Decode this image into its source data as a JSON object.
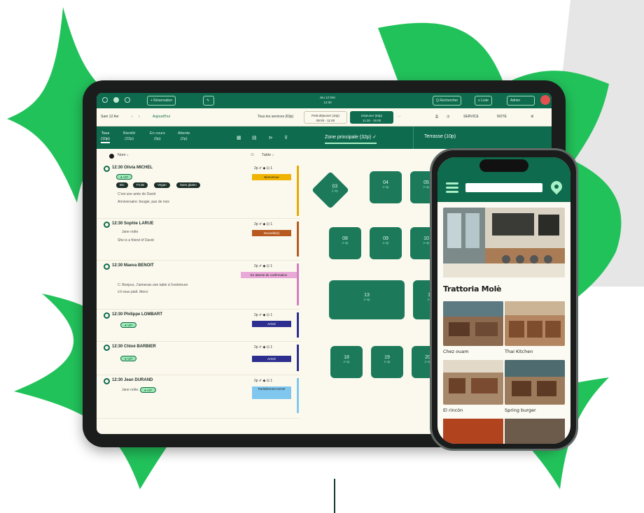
{
  "topbar": {
    "new_res_label": "+ Réservation",
    "center_line1": "Jeu 12 Déc",
    "center_line2": "12:30",
    "search_label": "Q Rechercher",
    "lists_label": "≡ Liste",
    "user_label": "Admin"
  },
  "toolbar": {
    "date": "Sam 12 Avr",
    "today": "Aujourd'hui",
    "all_services": "Tous les services (63p)",
    "service_lunch_line1": "Petit-déjeuner (10p)",
    "service_lunch_line2": "08:00 - 11:00",
    "service_dinner_line1": "Déjeuner (53p)",
    "service_dinner_line2": "11:30 - 15:00",
    "service_btn": "SERVICE",
    "note_btn": "NOTE"
  },
  "tabs": [
    {
      "line1": "Tous",
      "line2": "(10p)"
    },
    {
      "line1": "Bientôt",
      "line2": "(22p)"
    },
    {
      "line1": "En cours",
      "line2": "(9p)"
    },
    {
      "line1": "Attente",
      "line2": "(2p)"
    }
  ],
  "zones": {
    "main": "Zone principale (32p) ✓",
    "terrace": "Terrasse (10p)"
  },
  "list_header": {
    "sort_name": "Nom ↓",
    "sort_table": "Table ↓"
  },
  "reservations": [
    {
      "time_name": "12:30  Olivia MICHEL",
      "covers": "2p  ✐ ◆ ⊡ 1",
      "badge": "Bienvenue",
      "pill": "● VIP",
      "tags": [
        "Bio",
        "Fruits",
        "Vegan",
        "Sans gluten"
      ],
      "note1": "C'est une amie de David",
      "note2": "Anniversaire: bougie, pas de noix",
      "badge_color": "#f0b400",
      "bar_color": "#e8a900"
    },
    {
      "time_name": "12:30  Sophie LARUE",
      "covers": "2p  ✐ ◆ ⊡ 1",
      "badge": "Nouvelle(s)",
      "sub": "Jane notte",
      "note1": "She is a friend of David",
      "badge_color": "#b85a1f",
      "bar_color": "#b85a1f"
    },
    {
      "time_name": "12:30  Maeva BENOIT",
      "covers": "2p  ✐ ◆ ⊡ 1",
      "badge": "En attente de confirmation",
      "note1": "C: Bonjour, J'aimerais une table à l'extérieure",
      "note2": "s'il vous plaît. Merci",
      "badge_color": "#e9a9d8",
      "bar_color": "#d37ec1"
    },
    {
      "time_name": "12:30  Philippe LOMBART",
      "covers": "2p  ✐ ◆ ⊡ 1",
      "badge": "Arrivé",
      "pill": "● VIP",
      "badge_color": "#2d2f8f",
      "bar_color": "#2d2f8f"
    },
    {
      "time_name": "12:30  Chloé BARBIER",
      "covers": "2p  ✐ ◆ ⊡ 1",
      "badge": "Arrivé",
      "pill": "● VIP",
      "badge_color": "#2d2f8f",
      "bar_color": "#2d2f8f"
    },
    {
      "time_name": "12:30  Jean DURAND",
      "covers": "2p  ✐ ◆ ⊡ 1",
      "badge": "Partiellement arrivé",
      "pill": "● VIP",
      "sub": "Jane notte",
      "badge_color": "#7fc7ef",
      "bar_color": "#7fc7ef"
    }
  ],
  "tables": [
    {
      "num": "03",
      "sub": "2-4p"
    },
    {
      "num": "04",
      "sub": "2-4p"
    },
    {
      "num": "05",
      "sub": "2-4p"
    },
    {
      "num": "08",
      "sub": "2-4p"
    },
    {
      "num": "09",
      "sub": "2-4p"
    },
    {
      "num": "10",
      "sub": "2-4p"
    },
    {
      "num": "13",
      "sub": "2-4p"
    },
    {
      "num": "14",
      "sub": "2-4p"
    },
    {
      "num": "18",
      "sub": "2-4p"
    },
    {
      "num": "19",
      "sub": "2-4p"
    },
    {
      "num": "20",
      "sub": "2-4p"
    }
  ],
  "phone": {
    "restaurant_title": "Trattoria Molè",
    "cards": [
      "Chez ouam",
      "Thai Kitchen",
      "El rincón",
      "Spring burger"
    ]
  },
  "colors": {
    "brand_green": "#0e6b4d",
    "accent_green": "#22c25b",
    "mint": "#a8f0c6"
  }
}
